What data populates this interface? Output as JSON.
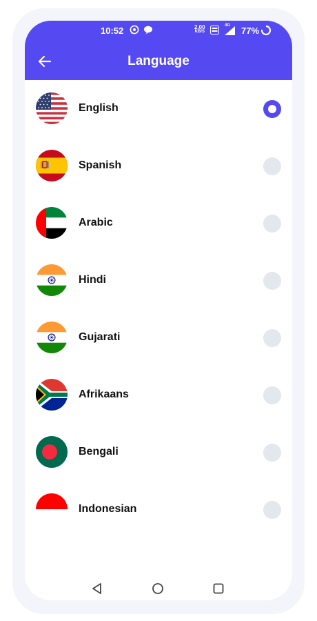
{
  "status_bar": {
    "time": "10:52",
    "speed_value": "2.00",
    "speed_unit": "KB/S",
    "network": "4G",
    "battery": "77%",
    "icons": [
      "whatsapp-icon",
      "message-icon",
      "volte-icon",
      "signal-icon",
      "battery-icon"
    ]
  },
  "header": {
    "title": "Language",
    "back_icon": "arrow-left-icon"
  },
  "languages": [
    {
      "label": "English",
      "flag": "usa-flag",
      "selected": true
    },
    {
      "label": "Spanish",
      "flag": "spain-flag",
      "selected": false
    },
    {
      "label": "Arabic",
      "flag": "uae-flag",
      "selected": false
    },
    {
      "label": "Hindi",
      "flag": "india-flag",
      "selected": false
    },
    {
      "label": "Gujarati",
      "flag": "india-flag",
      "selected": false
    },
    {
      "label": "Afrikaans",
      "flag": "south-africa-flag",
      "selected": false
    },
    {
      "label": "Bengali",
      "flag": "bangladesh-flag",
      "selected": false
    },
    {
      "label": "Indonesian",
      "flag": "indonesia-flag",
      "selected": false
    }
  ],
  "nav_bar": {
    "icons": [
      "back-triangle-icon",
      "home-circle-icon",
      "recents-square-icon"
    ]
  },
  "colors": {
    "accent": "#5549f2",
    "radio_off": "#e3e7ee"
  }
}
